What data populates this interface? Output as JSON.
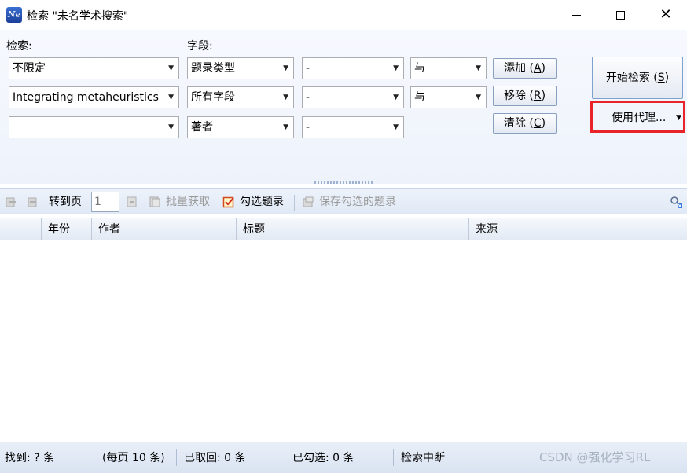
{
  "window": {
    "app_icon_text": "Ne",
    "title": "检索 \"未名学术搜索\""
  },
  "search": {
    "label_search": "检索:",
    "label_field": "字段:",
    "rows": [
      {
        "term": "不限定",
        "field": "题录类型",
        "operator": "-",
        "logic": "与"
      },
      {
        "term": "Integrating metaheuristics",
        "field": "所有字段",
        "operator": "-",
        "logic": "与"
      },
      {
        "term": "",
        "field": "著者",
        "operator": "-",
        "logic": ""
      }
    ],
    "add_label": "添加 (",
    "add_key": "A",
    "remove_label": "移除 (",
    "remove_key": "R",
    "clear_label": "清除 (",
    "clear_key": "C",
    "close_paren": ")",
    "start_label": "开始检索 (",
    "start_key": "S",
    "proxy_label": "使用代理..."
  },
  "toolbar": {
    "goto_label": "转到页",
    "page_value": "1",
    "batch_label": "批量获取",
    "check_label": "勾选题录",
    "save_label": "保存勾选的题录"
  },
  "grid": {
    "columns": [
      "年份",
      "作者",
      "标题",
      "来源"
    ]
  },
  "status": {
    "found": "找到: ? 条",
    "per_page": "(每页 10 条)",
    "fetched": "已取回: 0 条",
    "checked": "已勾选: 0 条",
    "state": "检索中断",
    "watermark": "CSDN @强化学习RL"
  },
  "colors": {
    "highlight_border": "#e8232a",
    "toolbar_bg": "#dfe8f5"
  }
}
